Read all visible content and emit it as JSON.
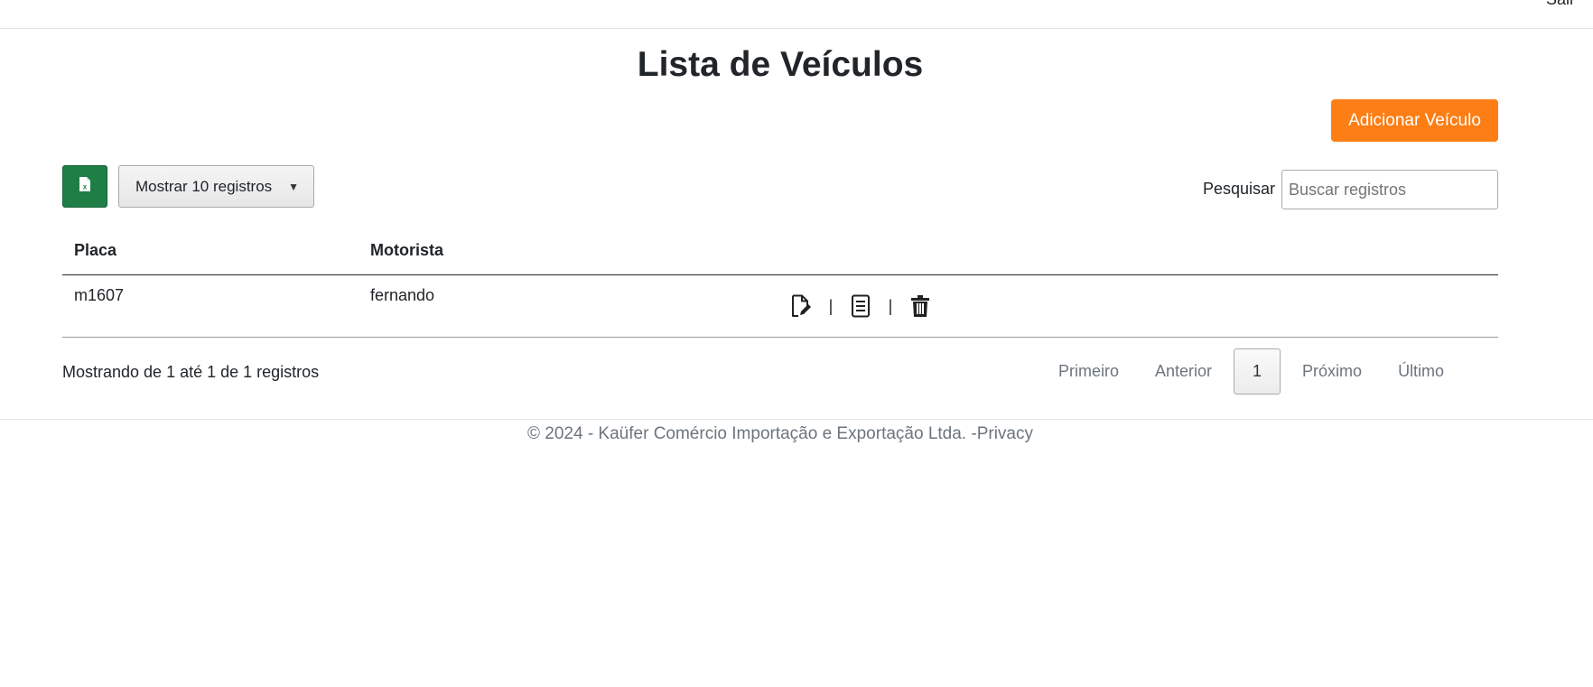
{
  "header": {
    "logout_label": "Sair"
  },
  "page": {
    "title": "Lista de Veículos"
  },
  "toolbar": {
    "add_label": "Adicionar Veículo",
    "excel_icon": "excel-file-icon",
    "length_label": "Mostrar 10 registros",
    "search_label": "Pesquisar",
    "search_placeholder": "Buscar registros",
    "search_value": ""
  },
  "table": {
    "columns": [
      "Placa",
      "Motorista",
      ""
    ],
    "rows": [
      {
        "placa": "m1607",
        "motorista": "fernando",
        "actions": [
          "edit-document-icon",
          "details-document-icon",
          "trash-icon"
        ],
        "separator": "|"
      }
    ]
  },
  "info": {
    "text": "Mostrando de 1 até 1 de 1 registros"
  },
  "pagination": {
    "first": "Primeiro",
    "previous": "Anterior",
    "current": "1",
    "next": "Próximo",
    "last": "Último"
  },
  "footer": {
    "copyright": "© 2024 - Kaüfer Comércio Importação e Exportação Ltda. -",
    "privacy_label": "Privacy"
  },
  "colors": {
    "accent_orange": "#fd7e14",
    "excel_green": "#1e7e45"
  }
}
